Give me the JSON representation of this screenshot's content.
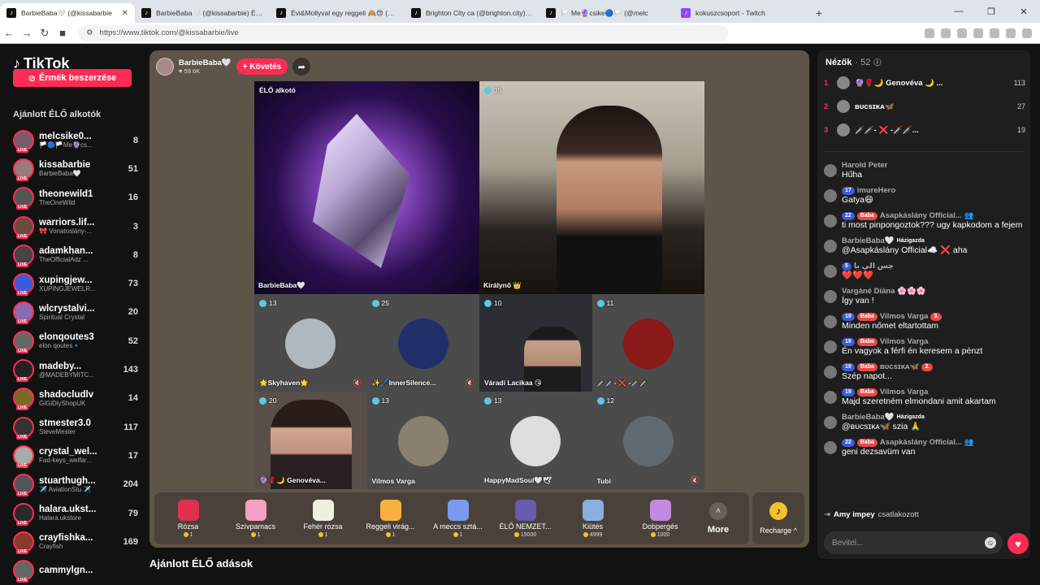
{
  "browser": {
    "tabs": [
      {
        "title": "BarbieBaba🤍 (@kissabarbie",
        "active": true
      },
      {
        "title": "BarbieBaba🤍 (@kissabarbie) ÉLŐ"
      },
      {
        "title": "Évi&Mollyval egy reggeli 🙈😍 (@m"
      },
      {
        "title": "Brighton City ca (@brighton.city) ÉLŐ"
      },
      {
        "title": "🏳️ Me🔮csike🔵🏳️ (@melc"
      },
      {
        "title": "kokuszcsoport - Twitch",
        "icon": "twitch"
      }
    ],
    "new_tab": "+",
    "win": {
      "min": "—",
      "max": "❐",
      "close": "✕"
    },
    "url": "https://www.tiktok.com/@kissabarbie/live"
  },
  "sidebar": {
    "logo": "TikTok",
    "coins_button": "Érmék beszerzése",
    "section_title": "Ajánlott ÉLŐ alkotók",
    "live_tag": "LIVE",
    "creators": [
      {
        "name": "melcsike0...",
        "sub": "🏳️🔵🏳️Me🔮cs...",
        "count": "8",
        "color": "#7a5a6a"
      },
      {
        "name": "kissabarbie",
        "sub": "BarbieBaba🤍",
        "count": "51",
        "color": "#9a7a7a"
      },
      {
        "name": "theonewild1",
        "sub": "TheOneWild",
        "count": "16",
        "color": "#555"
      },
      {
        "name": "warriors.lif...",
        "sub": "🎀 Vonatoslány-...",
        "count": "3",
        "color": "#6a4a3a"
      },
      {
        "name": "adamkhan...",
        "sub": "TheOfficialAdz ...",
        "count": "8",
        "color": "#444"
      },
      {
        "name": "xupingjew...",
        "sub": "XUPINGJEWELR...",
        "count": "73",
        "color": "#3b5bdb"
      },
      {
        "name": "wlcrystalvi...",
        "sub": "Spiritual Crystal",
        "count": "20",
        "color": "#8a6ab0"
      },
      {
        "name": "elonqoutes3",
        "sub": "elon qoutes🔹",
        "count": "52",
        "color": "#666"
      },
      {
        "name": "madeby...",
        "sub": "@MADEBYMITC...",
        "count": "143",
        "color": "#222"
      },
      {
        "name": "shadocludlv",
        "sub": "GiGiDiyShopUK",
        "count": "14",
        "color": "#7a6a2a"
      },
      {
        "name": "stmester3.0",
        "sub": "SteveMester",
        "count": "117",
        "color": "#333"
      },
      {
        "name": "crystal_wel...",
        "sub": "Fad-keys_welfar...",
        "count": "17",
        "color": "#aaa"
      },
      {
        "name": "stuarthugh...",
        "sub": "✈️ AviationStu ✈️",
        "count": "204",
        "color": "#555"
      },
      {
        "name": "halara.ukst...",
        "sub": "Halara.ukstore",
        "count": "79",
        "color": "#2a2a2a"
      },
      {
        "name": "crayfishka...",
        "sub": "Crayfish",
        "count": "169",
        "color": "#8a3a2a"
      },
      {
        "name": "cammylgn...",
        "sub": "",
        "count": "",
        "color": "#666"
      }
    ]
  },
  "stream": {
    "host_name": "BarbieBaba🤍",
    "host_likes": "59.6K",
    "follow_label": "+ Követés",
    "share_icon": "share-arrow-icon",
    "big_left": {
      "tag": "ÉLŐ alkotó",
      "name": "BarbieBaba🤍"
    },
    "big_right": {
      "viewers": "35",
      "name": "Királynő 👑"
    },
    "guests": [
      {
        "viewers": "13",
        "name": "🌟Skyhaven🌟",
        "color": "#b0b8bf",
        "muted": true
      },
      {
        "viewers": "25",
        "name": "✨🖊️InnerSilence...",
        "color": "#1f2f6a",
        "muted": true
      },
      {
        "viewers": "10",
        "name": "Váradi Lacikaa 😘",
        "color": "",
        "muted": false
      },
      {
        "viewers": "11",
        "name": "🗡️🗡️- ❌ -🗡️🗡️",
        "color": "#8a1a1a",
        "muted": false
      },
      {
        "viewers": "20",
        "name": "🔮🌹🌙 Genovéva...",
        "color": "",
        "muted": false
      },
      {
        "viewers": "13",
        "name": "Vilmos Varga",
        "color": "#8a8070",
        "muted": false
      },
      {
        "viewers": "13",
        "name": "HappyMadSoul🤍🕊",
        "color": "#ddd",
        "muted": false
      },
      {
        "viewers": "12",
        "name": "Tubi",
        "color": "#606a70",
        "muted": true
      }
    ]
  },
  "gifts": {
    "items": [
      {
        "name": "Rózsa",
        "price": "1",
        "color": "#e03050"
      },
      {
        "name": "Szívpamacs",
        "price": "1",
        "color": "#f5a0c0"
      },
      {
        "name": "Fehér rózsa",
        "price": "1",
        "color": "#f0f0e0"
      },
      {
        "name": "Reggeli virág...",
        "price": "1",
        "color": "#f5b040"
      },
      {
        "name": "A meccs sztá...",
        "price": "1",
        "color": "#7a9af0"
      },
      {
        "name": "ÉLŐ NEMZET...",
        "price": "15000",
        "color": "#6a5ab0"
      },
      {
        "name": "Kiütés",
        "price": "4999",
        "color": "#8ab0e0"
      },
      {
        "name": "Dobpergés",
        "price": "1000",
        "color": "#c08ae0"
      }
    ],
    "more_label": "More",
    "recharge_label": "Recharge ^"
  },
  "recommend_title": "Ajánlott ÉLŐ adások",
  "chat": {
    "viewers_label": "Nézők",
    "viewers_count": "· 52",
    "top_viewers": [
      {
        "rank": "1",
        "name": "🔮🌹🌙 Genovéva 🌙 ...",
        "score": "113"
      },
      {
        "rank": "2",
        "name": "ʙᴜᴄsɪᴋᴀ🦋",
        "score": "27"
      },
      {
        "rank": "3",
        "name": "🗡️🗡️- ❌ -🗡️🗡️...",
        "score": "19"
      }
    ],
    "messages": [
      {
        "name": "Harold Peter",
        "level": "",
        "fan": "",
        "extra": "",
        "text": "Hűha"
      },
      {
        "name": "imureHero",
        "level": "17",
        "fan": "",
        "extra": "",
        "text": "Gatya😄"
      },
      {
        "name": "Asapkáslány Official...",
        "level": "22",
        "fan": "Baba",
        "extra": "👥",
        "text": "ti most pinpongoztok??? ugy kapkodom a fejem"
      },
      {
        "name": "BarbieBaba🤍",
        "level": "",
        "fan": "",
        "extra": "Házigazda",
        "text": "@Asapkáslány Official☁️ ❌ aha"
      },
      {
        "name": "چس الي يا",
        "level": "5",
        "fan": "",
        "extra": "",
        "text": "❤️❤️❤️"
      },
      {
        "name": "Vargáné Diána 🌸🌸🌸",
        "level": "",
        "fan": "",
        "extra": "",
        "text": "Így van !"
      },
      {
        "name": "Vilmos Varga",
        "level": "19",
        "fan": "Baba",
        "extra": "3.",
        "text": "Minden nőmet eltartottam"
      },
      {
        "name": "Vilmos Varga",
        "level": "19",
        "fan": "Baba",
        "extra": "",
        "text": "Én vagyok a férfi én keresem a pénzt"
      },
      {
        "name": "ʙᴜᴄsɪᴋᴀ🦋",
        "level": "19",
        "fan": "Baba",
        "extra": "2.",
        "text": "Szép napot..."
      },
      {
        "name": "Vilmos Varga",
        "level": "19",
        "fan": "Baba",
        "extra": "",
        "text": "Majd szeretném elmondani amit akartam"
      },
      {
        "name": "BarbieBaba🤍",
        "level": "",
        "fan": "",
        "extra": "Házigazda",
        "text": "@ʙᴜᴄsɪᴋᴀ🦋 szia 🙏"
      },
      {
        "name": "Asapkáslány Official...",
        "level": "22",
        "fan": "Baba",
        "extra": "👥",
        "text": "geni dezsavüm van"
      }
    ],
    "joined": {
      "name": "Amy impey",
      "text": "csatlakozott"
    },
    "input_placeholder": "Bevitel..."
  }
}
